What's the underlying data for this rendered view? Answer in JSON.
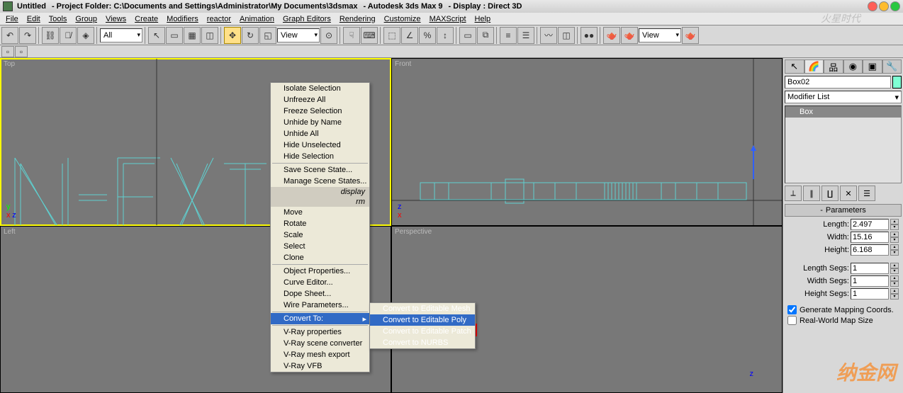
{
  "title": {
    "doc": "Untitled",
    "folder_label": "- Project Folder: C:\\Documents and Settings\\Administrator\\My Documents\\3dsmax",
    "app": "- Autodesk 3ds Max 9",
    "display": "- Display : Direct 3D"
  },
  "menu": [
    "File",
    "Edit",
    "Tools",
    "Group",
    "Views",
    "Create",
    "Modifiers",
    "reactor",
    "Animation",
    "Graph Editors",
    "Rendering",
    "Customize",
    "MAXScript",
    "Help"
  ],
  "toolbar": {
    "filter": "All",
    "view_label": "View",
    "view2_label": "View"
  },
  "viewports": {
    "top": "Top",
    "front": "Front",
    "left": "Left",
    "persp": "Perspective"
  },
  "context_menu": {
    "items1": [
      "Isolate Selection",
      "Unfreeze All",
      "Freeze Selection",
      "Unhide by Name",
      "Unhide All",
      "Hide Unselected",
      "Hide Selection",
      "Save Scene State...",
      "Manage Scene States..."
    ],
    "header_display": "display",
    "header_rm": "rm",
    "items2": [
      "Move",
      "Rotate",
      "Scale",
      "Select",
      "Clone",
      "Object Properties...",
      "Curve Editor...",
      "Dope Sheet...",
      "Wire Parameters..."
    ],
    "convert_to": "Convert To:",
    "items3": [
      "V-Ray properties",
      "V-Ray scene converter",
      "V-Ray mesh export",
      "V-Ray VFB"
    ],
    "submenu": [
      "Convert to Editable Mesh",
      "Convert to Editable Poly",
      "Convert to Editable Patch",
      "Convert to NURBS"
    ]
  },
  "cmd_panel": {
    "object_name": "Box02",
    "modifier_list": "Modifier List",
    "stack_item": "Box",
    "rollout_params": "Parameters",
    "params": {
      "length_lbl": "Length:",
      "length": "2.497",
      "width_lbl": "Width:",
      "width": "15.16",
      "height_lbl": "Height:",
      "height": "6.168",
      "lsegs_lbl": "Length Segs:",
      "lsegs": "1",
      "wsegs_lbl": "Width Segs:",
      "wsegs": "1",
      "hsegs_lbl": "Height Segs:",
      "hsegs": "1"
    },
    "gen_map": "Generate Mapping Coords.",
    "real_world": "Real-World Map Size"
  }
}
